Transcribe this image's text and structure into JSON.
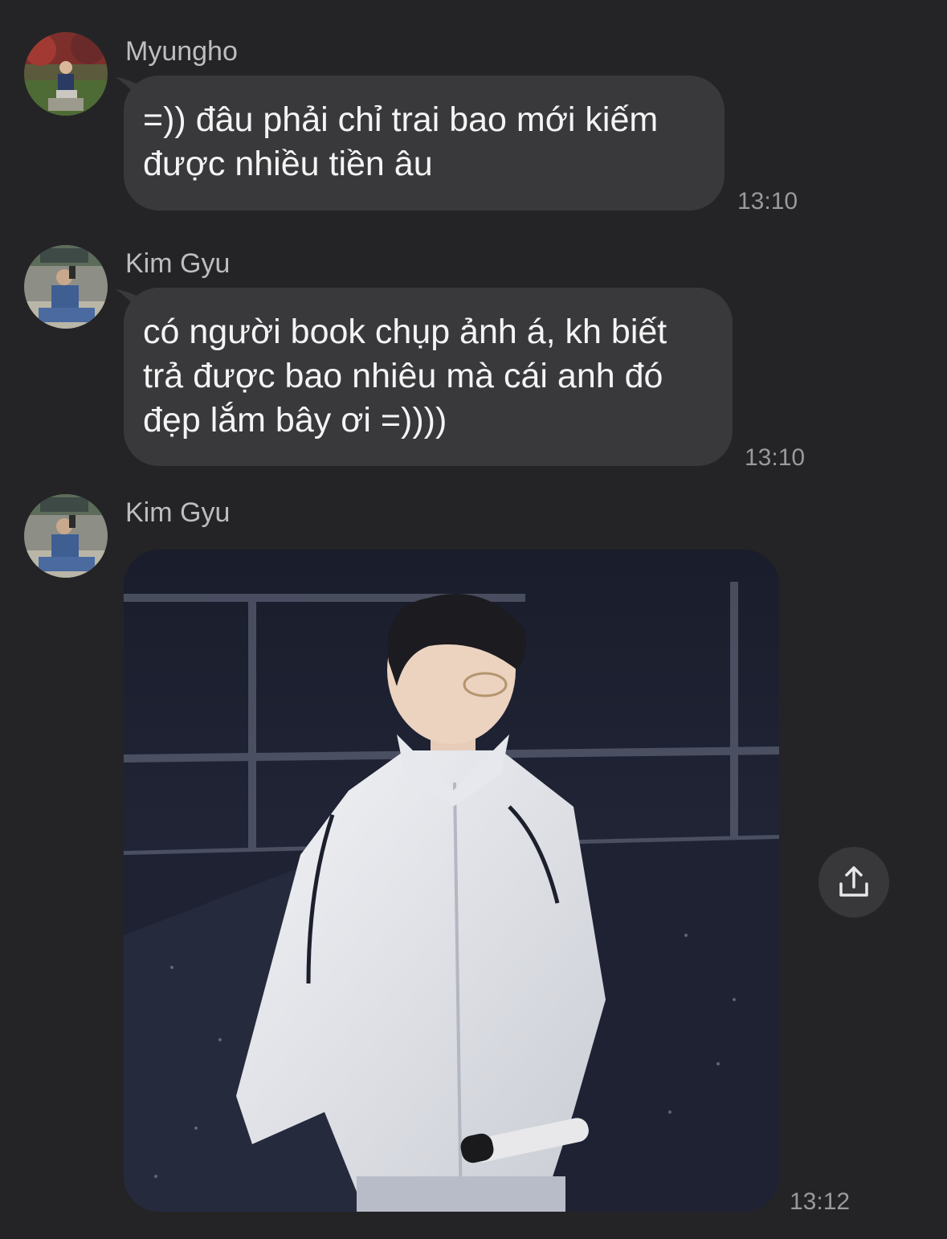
{
  "messages": [
    {
      "sender": "Myungho",
      "text": "=)) đâu phải chỉ trai bao mới kiếm\nđược nhiều tiền âu",
      "time": "13:10"
    },
    {
      "sender": "Kim Gyu",
      "text": "có người book chụp ảnh á, kh biết\ntrả được bao nhiêu mà cái anh đó\nđẹp lắm bây ơi =))))",
      "time": "13:10"
    },
    {
      "sender": "Kim Gyu",
      "attachment": "photo",
      "time": "13:12"
    }
  ],
  "icons": {
    "share": "share-icon"
  },
  "colors": {
    "background": "#242426",
    "bubble": "#39393c",
    "message_text": "#f4f4f4",
    "sender_name": "#bdbdc1",
    "timestamp": "#9a9a9e"
  }
}
